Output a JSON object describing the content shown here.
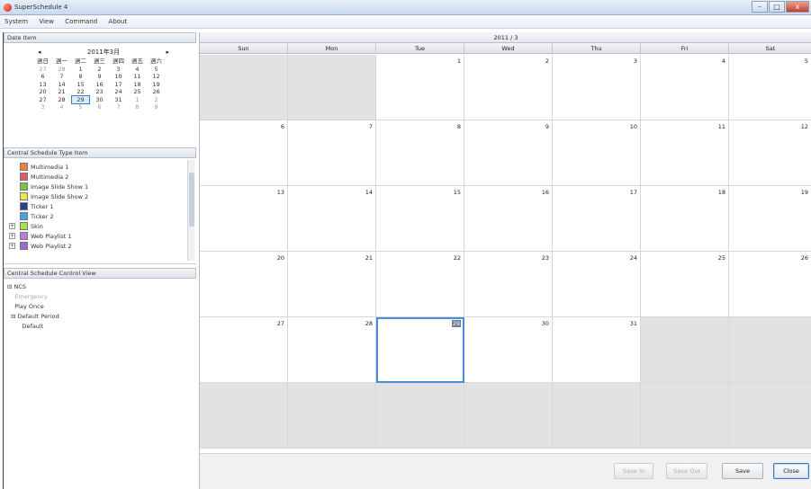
{
  "window": {
    "title": "SuperSchedule 4",
    "min_glyph": "–",
    "max_glyph": "□",
    "close_glyph": "x"
  },
  "menu": [
    "System",
    "View",
    "Command",
    "About"
  ],
  "date_panel": {
    "header": "Date Item",
    "month_label": "2011年3月",
    "prev_glyph": "◂",
    "next_glyph": "▸",
    "weekday_headers": [
      "週日",
      "週一",
      "週二",
      "週三",
      "週四",
      "週五",
      "週六"
    ],
    "weeks": [
      [
        "27",
        "28",
        "1",
        "2",
        "3",
        "4",
        "5"
      ],
      [
        "6",
        "7",
        "8",
        "9",
        "10",
        "11",
        "12"
      ],
      [
        "13",
        "14",
        "15",
        "16",
        "17",
        "18",
        "19"
      ],
      [
        "20",
        "21",
        "22",
        "23",
        "24",
        "25",
        "26"
      ],
      [
        "27",
        "28",
        "29",
        "30",
        "31",
        "1",
        "2"
      ],
      [
        "3",
        "4",
        "5",
        "6",
        "7",
        "8",
        "9"
      ]
    ]
  },
  "type_panel": {
    "header": "Central Schedule Type Item",
    "items": [
      {
        "label": "Multimedia 1",
        "color": "#e8853a"
      },
      {
        "label": "Multimedia 2",
        "color": "#e05a6a"
      },
      {
        "label": "Image Slide Show 1",
        "color": "#7cc24a"
      },
      {
        "label": "Image Slide Show 2",
        "color": "#e9e64a"
      },
      {
        "label": "Ticker 1",
        "color": "#2b3f8c"
      },
      {
        "label": "Ticker 2",
        "color": "#4aa3e0"
      },
      {
        "label": "Skin",
        "color": "#a9e34a"
      },
      {
        "label": "Web Playlist 1",
        "color": "#c27ae0"
      },
      {
        "label": "Web Playlist 2",
        "color": "#9a6ad4"
      }
    ]
  },
  "control_panel": {
    "header": "Central Schedule Control View",
    "tree": [
      {
        "label": "⊟ NCS",
        "dim": false
      },
      {
        "label": "    Emergency",
        "dim": true
      },
      {
        "label": "    Play Once",
        "dim": false
      },
      {
        "label": "  ⊟ Default Period",
        "dim": false
      },
      {
        "label": "        Default",
        "dim": false
      }
    ]
  },
  "calendar": {
    "title": "2011 / 3",
    "weekdays": [
      "Sun",
      "Mon",
      "Tue",
      "Wed",
      "Thu",
      "Fri",
      "Sat"
    ],
    "weeks": [
      [
        "",
        "",
        "1",
        "2",
        "3",
        "4",
        "5"
      ],
      [
        "6",
        "7",
        "8",
        "9",
        "10",
        "11",
        "12"
      ],
      [
        "13",
        "14",
        "15",
        "16",
        "17",
        "18",
        "19"
      ],
      [
        "20",
        "21",
        "22",
        "23",
        "24",
        "25",
        "26"
      ],
      [
        "27",
        "28",
        "29",
        "30",
        "31",
        "",
        ""
      ],
      [
        "",
        "",
        "",
        "",
        "",
        "",
        ""
      ]
    ],
    "selected_day": "29"
  },
  "footer": {
    "buttons": [
      "Save In",
      "Save Out",
      "Save",
      "Close"
    ],
    "disabled": [
      true,
      true,
      false,
      false
    ]
  }
}
